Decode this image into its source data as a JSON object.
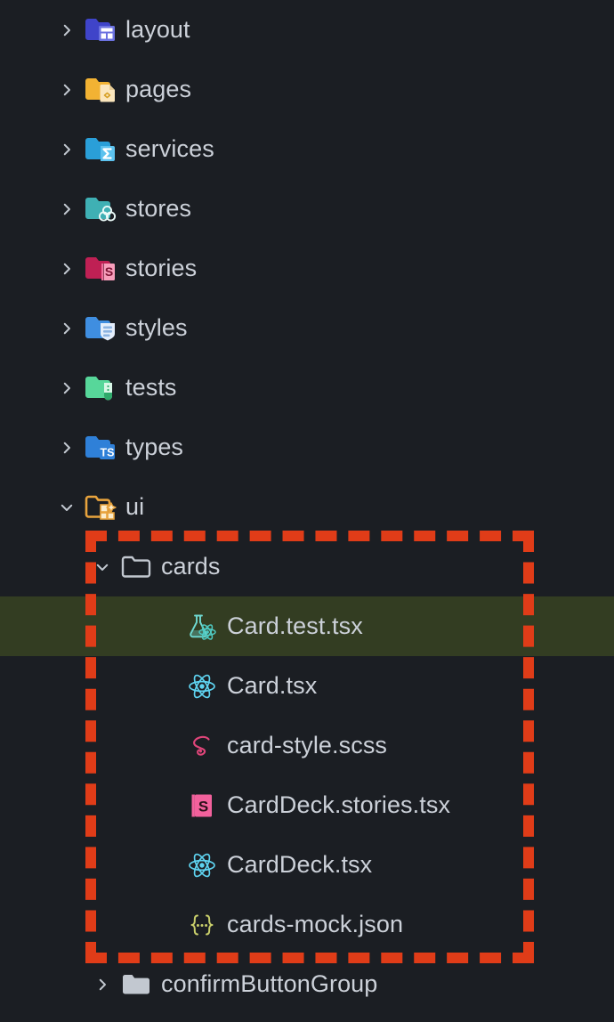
{
  "theme": {
    "background": "#1b1e23",
    "text": "#ccd1d9",
    "selected_row_background": "#333d22",
    "annotation_border": "#e03c18"
  },
  "file_tree": {
    "rows": [
      {
        "label": "layout",
        "icon": "folder-layout-icon",
        "twisty": "chevron-right",
        "level": 1,
        "selected": false
      },
      {
        "label": "pages",
        "icon": "folder-pages-icon",
        "twisty": "chevron-right",
        "level": 1,
        "selected": false
      },
      {
        "label": "services",
        "icon": "folder-services-icon",
        "twisty": "chevron-right",
        "level": 1,
        "selected": false
      },
      {
        "label": "stores",
        "icon": "folder-stores-icon",
        "twisty": "chevron-right",
        "level": 1,
        "selected": false
      },
      {
        "label": "stories",
        "icon": "folder-stories-icon",
        "twisty": "chevron-right",
        "level": 1,
        "selected": false
      },
      {
        "label": "styles",
        "icon": "folder-styles-icon",
        "twisty": "chevron-right",
        "level": 1,
        "selected": false
      },
      {
        "label": "tests",
        "icon": "folder-tests-icon",
        "twisty": "chevron-right",
        "level": 1,
        "selected": false
      },
      {
        "label": "types",
        "icon": "folder-types-icon",
        "twisty": "chevron-right",
        "level": 1,
        "selected": false
      },
      {
        "label": "ui",
        "icon": "folder-ui-icon",
        "twisty": "chevron-down",
        "level": 1,
        "selected": false
      },
      {
        "label": "cards",
        "icon": "folder-open-outline-icon",
        "twisty": "chevron-down",
        "level": 2,
        "selected": false
      },
      {
        "label": "Card.test.tsx",
        "icon": "file-test-react-icon",
        "twisty": "none",
        "level": 3,
        "selected": true
      },
      {
        "label": "Card.tsx",
        "icon": "file-react-icon",
        "twisty": "none",
        "level": 3,
        "selected": false
      },
      {
        "label": "card-style.scss",
        "icon": "file-sass-icon",
        "twisty": "none",
        "level": 3,
        "selected": false
      },
      {
        "label": "CardDeck.stories.tsx",
        "icon": "file-storybook-icon",
        "twisty": "none",
        "level": 3,
        "selected": false
      },
      {
        "label": "CardDeck.tsx",
        "icon": "file-react-icon",
        "twisty": "none",
        "level": 3,
        "selected": false
      },
      {
        "label": "cards-mock.json",
        "icon": "file-json-icon",
        "twisty": "none",
        "level": 3,
        "selected": false
      },
      {
        "label": "confirmButtonGroup",
        "icon": "folder-plain-icon",
        "twisty": "chevron-right",
        "level": 2,
        "selected": false
      }
    ]
  },
  "annotation": {
    "name": "dashed-highlight-box",
    "color": "#e03c18",
    "style": "dashed"
  }
}
